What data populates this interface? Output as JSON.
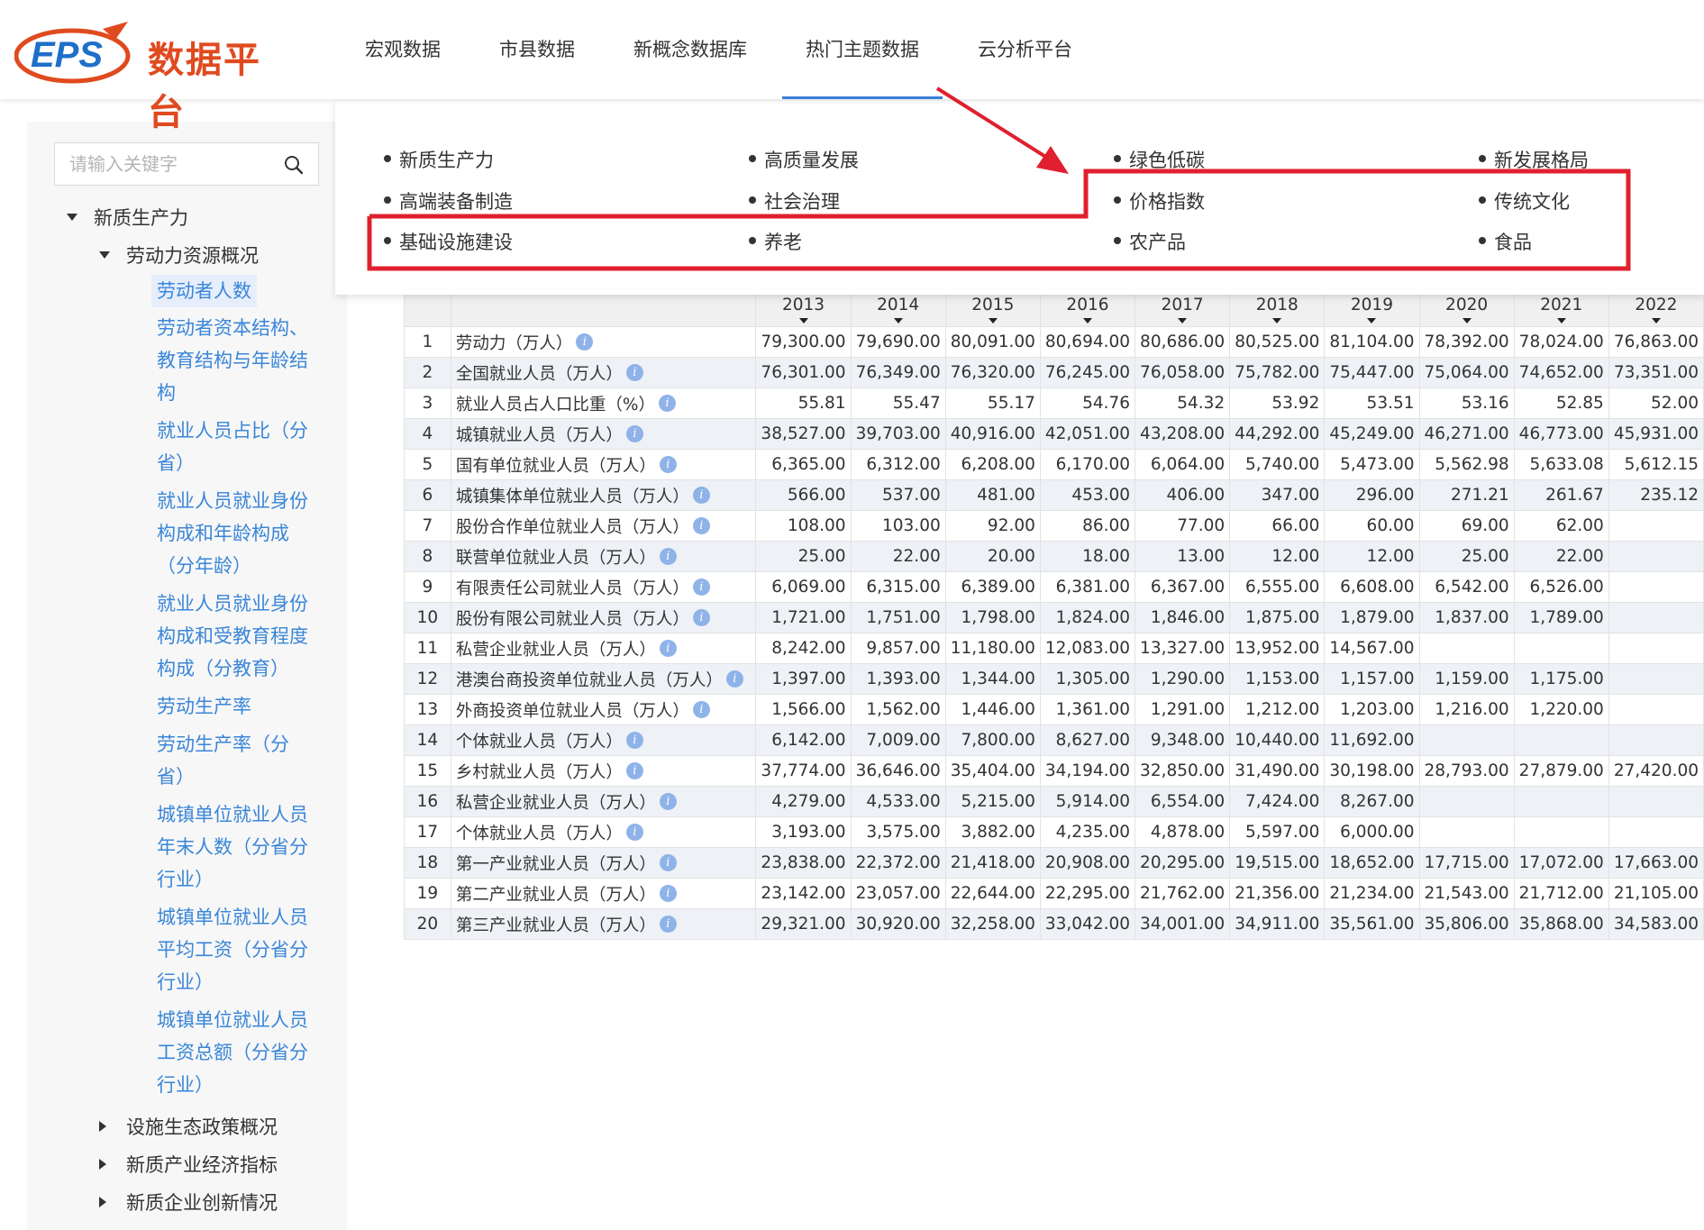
{
  "header": {
    "logo_mark": "EPS",
    "logo_text": "数据平台",
    "nav": [
      "宏观数据",
      "市县数据",
      "新概念数据库",
      "热门主题数据",
      "云分析平台"
    ],
    "active_nav": "热门主题数据"
  },
  "sidebar": {
    "search_placeholder": "请输入关键字",
    "root": "新质生产力",
    "group": "劳动力资源概况",
    "leaves": [
      "劳动者人数",
      [
        "劳动者资本结构、",
        "教育结构与年龄结",
        "构"
      ],
      [
        "就业人员占比（分",
        "省）"
      ],
      [
        "就业人员就业身份",
        "构成和年龄构成",
        "（分年龄）"
      ],
      [
        "就业人员就业身份",
        "构成和受教育程度",
        "构成（分教育）"
      ],
      "劳动生产率",
      [
        "劳动生产率（分",
        "省）"
      ],
      [
        "城镇单位就业人员",
        "年末人数（分省分",
        "行业）"
      ],
      [
        "城镇单位就业人员",
        "平均工资（分省分",
        "行业）"
      ],
      [
        "城镇单位就业人员",
        "工资总额（分省分",
        "行业）"
      ]
    ],
    "collapsed": [
      "设施生态政策概况",
      "新质产业经济指标",
      "新质企业创新情况"
    ]
  },
  "dropdown": {
    "columns": [
      [
        "新质生产力",
        "高端装备制造",
        "基础设施建设"
      ],
      [
        "高质量发展",
        "社会治理",
        "养老"
      ],
      [
        "绿色低碳",
        "价格指数",
        "农产品"
      ],
      [
        "新发展格局",
        "传统文化",
        "食品"
      ]
    ]
  },
  "colors": {
    "accent": "#3a86d8",
    "brand": "#e04a1f",
    "annotation": "#e0202e"
  },
  "table": {
    "years": [
      "2013",
      "2014",
      "2015",
      "2016",
      "2017",
      "2018",
      "2019",
      "2020",
      "2021",
      "2022"
    ],
    "rows": [
      {
        "idx": "1",
        "name": "劳动力（万人）",
        "v": [
          "79,300.00",
          "79,690.00",
          "80,091.00",
          "80,694.00",
          "80,686.00",
          "80,525.00",
          "81,104.00",
          "78,392.00",
          "78,024.00",
          "76,863.00"
        ]
      },
      {
        "idx": "2",
        "name": "全国就业人员（万人）",
        "v": [
          "76,301.00",
          "76,349.00",
          "76,320.00",
          "76,245.00",
          "76,058.00",
          "75,782.00",
          "75,447.00",
          "75,064.00",
          "74,652.00",
          "73,351.00"
        ]
      },
      {
        "idx": "3",
        "name": "就业人员占人口比重（%）",
        "v": [
          "55.81",
          "55.47",
          "55.17",
          "54.76",
          "54.32",
          "53.92",
          "53.51",
          "53.16",
          "52.85",
          "52.00"
        ]
      },
      {
        "idx": "4",
        "name": "城镇就业人员（万人）",
        "v": [
          "38,527.00",
          "39,703.00",
          "40,916.00",
          "42,051.00",
          "43,208.00",
          "44,292.00",
          "45,249.00",
          "46,271.00",
          "46,773.00",
          "45,931.00"
        ]
      },
      {
        "idx": "5",
        "name": "国有单位就业人员（万人）",
        "v": [
          "6,365.00",
          "6,312.00",
          "6,208.00",
          "6,170.00",
          "6,064.00",
          "5,740.00",
          "5,473.00",
          "5,562.98",
          "5,633.08",
          "5,612.15"
        ]
      },
      {
        "idx": "6",
        "name": "城镇集体单位就业人员（万人）",
        "v": [
          "566.00",
          "537.00",
          "481.00",
          "453.00",
          "406.00",
          "347.00",
          "296.00",
          "271.21",
          "261.67",
          "235.12"
        ]
      },
      {
        "idx": "7",
        "name": "股份合作单位就业人员（万人）",
        "v": [
          "108.00",
          "103.00",
          "92.00",
          "86.00",
          "77.00",
          "66.00",
          "60.00",
          "69.00",
          "62.00",
          ""
        ]
      },
      {
        "idx": "8",
        "name": "联营单位就业人员（万人）",
        "v": [
          "25.00",
          "22.00",
          "20.00",
          "18.00",
          "13.00",
          "12.00",
          "12.00",
          "25.00",
          "22.00",
          ""
        ]
      },
      {
        "idx": "9",
        "name": "有限责任公司就业人员（万人）",
        "v": [
          "6,069.00",
          "6,315.00",
          "6,389.00",
          "6,381.00",
          "6,367.00",
          "6,555.00",
          "6,608.00",
          "6,542.00",
          "6,526.00",
          ""
        ]
      },
      {
        "idx": "10",
        "name": "股份有限公司就业人员（万人）",
        "v": [
          "1,721.00",
          "1,751.00",
          "1,798.00",
          "1,824.00",
          "1,846.00",
          "1,875.00",
          "1,879.00",
          "1,837.00",
          "1,789.00",
          ""
        ]
      },
      {
        "idx": "11",
        "name": "私营企业就业人员（万人）",
        "v": [
          "8,242.00",
          "9,857.00",
          "11,180.00",
          "12,083.00",
          "13,327.00",
          "13,952.00",
          "14,567.00",
          "",
          "",
          ""
        ]
      },
      {
        "idx": "12",
        "name": "港澳台商投资单位就业人员（万人）",
        "v": [
          "1,397.00",
          "1,393.00",
          "1,344.00",
          "1,305.00",
          "1,290.00",
          "1,153.00",
          "1,157.00",
          "1,159.00",
          "1,175.00",
          ""
        ]
      },
      {
        "idx": "13",
        "name": "外商投资单位就业人员（万人）",
        "v": [
          "1,566.00",
          "1,562.00",
          "1,446.00",
          "1,361.00",
          "1,291.00",
          "1,212.00",
          "1,203.00",
          "1,216.00",
          "1,220.00",
          ""
        ]
      },
      {
        "idx": "14",
        "name": "个体就业人员（万人）",
        "v": [
          "6,142.00",
          "7,009.00",
          "7,800.00",
          "8,627.00",
          "9,348.00",
          "10,440.00",
          "11,692.00",
          "",
          "",
          ""
        ]
      },
      {
        "idx": "15",
        "name": "乡村就业人员（万人）",
        "v": [
          "37,774.00",
          "36,646.00",
          "35,404.00",
          "34,194.00",
          "32,850.00",
          "31,490.00",
          "30,198.00",
          "28,793.00",
          "27,879.00",
          "27,420.00"
        ]
      },
      {
        "idx": "16",
        "name": "私营企业就业人员（万人）",
        "v": [
          "4,279.00",
          "4,533.00",
          "5,215.00",
          "5,914.00",
          "6,554.00",
          "7,424.00",
          "8,267.00",
          "",
          "",
          ""
        ]
      },
      {
        "idx": "17",
        "name": "个体就业人员（万人）",
        "v": [
          "3,193.00",
          "3,575.00",
          "3,882.00",
          "4,235.00",
          "4,878.00",
          "5,597.00",
          "6,000.00",
          "",
          "",
          ""
        ]
      },
      {
        "idx": "18",
        "name": "第一产业就业人员（万人）",
        "v": [
          "23,838.00",
          "22,372.00",
          "21,418.00",
          "20,908.00",
          "20,295.00",
          "19,515.00",
          "18,652.00",
          "17,715.00",
          "17,072.00",
          "17,663.00"
        ]
      },
      {
        "idx": "19",
        "name": "第二产业就业人员（万人）",
        "v": [
          "23,142.00",
          "23,057.00",
          "22,644.00",
          "22,295.00",
          "21,762.00",
          "21,356.00",
          "21,234.00",
          "21,543.00",
          "21,712.00",
          "21,105.00"
        ]
      },
      {
        "idx": "20",
        "name": "第三产业就业人员（万人）",
        "v": [
          "29,321.00",
          "30,920.00",
          "32,258.00",
          "33,042.00",
          "34,001.00",
          "34,911.00",
          "35,561.00",
          "35,806.00",
          "35,868.00",
          "34,583.00"
        ]
      }
    ]
  }
}
